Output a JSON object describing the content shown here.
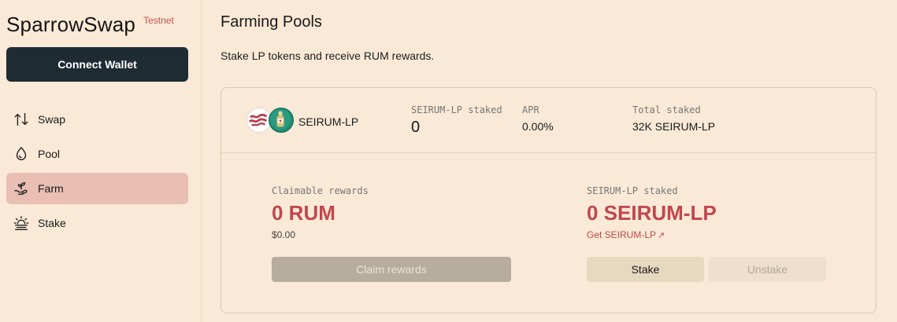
{
  "app": {
    "name": "SparrowSwap",
    "badge": "Testnet"
  },
  "sidebar": {
    "connect_label": "Connect Wallet",
    "items": [
      {
        "label": "Swap",
        "icon": "swap-icon"
      },
      {
        "label": "Pool",
        "icon": "droplet-icon"
      },
      {
        "label": "Farm",
        "icon": "plant-hand-icon",
        "active": true
      },
      {
        "label": "Stake",
        "icon": "sun-stake-icon"
      }
    ]
  },
  "page": {
    "title": "Farming Pools",
    "subtitle": "Stake LP tokens and receive RUM rewards."
  },
  "pool": {
    "pair": "SEIRUM-LP",
    "staked_label": "SEIRUM-LP staked",
    "staked_value": "0",
    "apr_label": "APR",
    "apr_value": "0.00%",
    "total_label": "Total staked",
    "total_value": "32K SEIRUM-LP",
    "claimable_label": "Claimable rewards",
    "claimable_value": "0 RUM",
    "claimable_usd": "$0.00",
    "my_staked_label": "SEIRUM-LP staked",
    "my_staked_value": "0 SEIRUM-LP",
    "get_link": "Get SEIRUM-LP",
    "claim_button": "Claim rewards",
    "stake_button": "Stake",
    "unstake_button": "Unstake"
  },
  "colors": {
    "accent": "#c0474f",
    "background": "#f9e9d6",
    "dark_button": "#1e2b33",
    "active_nav": "#e9bfb4"
  }
}
